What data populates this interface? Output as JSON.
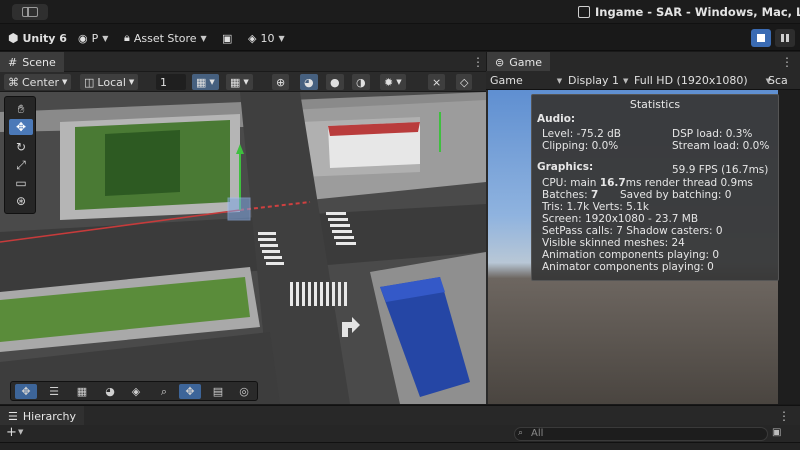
{
  "window": {
    "title": "Ingame - SAR - Windows, Mac, Linux"
  },
  "toolbar": {
    "unity_label": "Unity 6",
    "account_label": "P",
    "asset_store_label": "Asset Store",
    "layers_count": "10"
  },
  "scene": {
    "tab_label": "Scene",
    "pivot_label": "Center",
    "space_label": "Local",
    "grid_value": "1"
  },
  "game": {
    "tab_label": "Game",
    "mode_label": "Game",
    "display_label": "Display 1",
    "resolution_label": "Full HD (1920x1080)",
    "scale_label": "Sca"
  },
  "statistics": {
    "title": "Statistics",
    "audio_header": "Audio:",
    "level": "Level: -75.2 dB",
    "clipping": "Clipping: 0.0%",
    "dsp_load": "DSP load: 0.3%",
    "stream_load": "Stream load: 0.0%",
    "graphics_header": "Graphics:",
    "fps": "59.9 FPS (16.7ms)",
    "cpu_prefix": "CPU: main",
    "cpu_main_ms": "16.7",
    "cpu_suffix": "ms  render thread 0.9ms",
    "batches_prefix": "Batches:",
    "batches_value": "7",
    "saved_by_batching": "Saved by batching: 0",
    "tris_verts": "Tris: 1.7k   Verts: 5.1k",
    "screen": "Screen: 1920x1080 - 23.7 MB",
    "setpass": "SetPass calls: 7  Shadow casters: 0",
    "skinned": "Visible skinned meshes: 24",
    "anim_components": "Animation components playing: 0",
    "animator_components": "Animator components playing: 0"
  },
  "hierarchy": {
    "tab_label": "Hierarchy",
    "search_placeholder": "All",
    "add_label": "+"
  },
  "colors": {
    "accent": "#3a6bb3",
    "panel": "#282828",
    "background": "#191919"
  }
}
